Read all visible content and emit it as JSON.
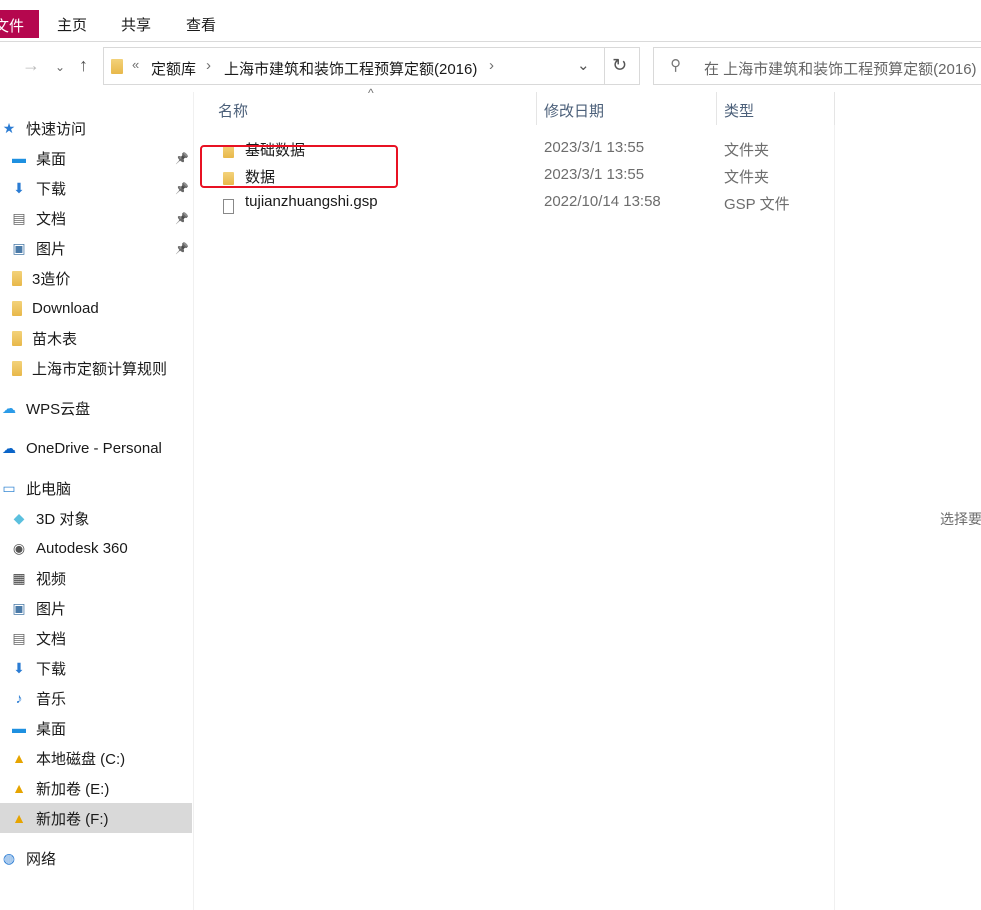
{
  "ribbon": {
    "tabs": [
      "文件",
      "主页",
      "共享",
      "查看"
    ],
    "accent": "#b5074e"
  },
  "address": {
    "prefix": "«",
    "crumbs": [
      "定额库",
      "上海市建筑和装饰工程预算定额(2016)"
    ]
  },
  "search": {
    "placeholder": "在 上海市建筑和装饰工程预算定额(2016)"
  },
  "columns": {
    "name": "名称",
    "date": "修改日期",
    "type": "类型"
  },
  "files": [
    {
      "name": "基础数据",
      "date": "2023/3/1 13:55",
      "type": "文件夹",
      "icon": "folder-icon"
    },
    {
      "name": "数据",
      "date": "2023/3/1 13:55",
      "type": "文件夹",
      "icon": "folder-icon"
    },
    {
      "name": "tujianzhuangshi.gsp",
      "date": "2022/10/14 13:58",
      "type": "GSP 文件",
      "icon": "file-icon"
    }
  ],
  "highlight_color": "#e81123",
  "sidebar": [
    {
      "label": "快速访问",
      "icon": "star-icon",
      "pinned": false
    },
    {
      "label": "桌面",
      "icon": "desktop-icon",
      "pinned": true
    },
    {
      "label": "下载",
      "icon": "download-icon",
      "pinned": true
    },
    {
      "label": "文档",
      "icon": "document-icon",
      "pinned": true
    },
    {
      "label": "图片",
      "icon": "pictures-icon",
      "pinned": true
    },
    {
      "label": "3造价",
      "icon": "folder-icon"
    },
    {
      "label": "Download",
      "icon": "folder-icon"
    },
    {
      "label": "苗木表",
      "icon": "folder-icon"
    },
    {
      "label": "上海市定额计算规则",
      "icon": "folder-icon"
    },
    {
      "label": "WPS云盘",
      "icon": "cloud-icon"
    },
    {
      "label": "OneDrive - Personal",
      "icon": "onedrive-icon"
    },
    {
      "label": "此电脑",
      "icon": "computer-icon"
    },
    {
      "label": "3D 对象",
      "icon": "3d-objects-icon"
    },
    {
      "label": "Autodesk 360",
      "icon": "autodesk-icon"
    },
    {
      "label": "视频",
      "icon": "video-icon"
    },
    {
      "label": "图片",
      "icon": "pictures-icon"
    },
    {
      "label": "文档",
      "icon": "document-icon"
    },
    {
      "label": "下载",
      "icon": "download-icon"
    },
    {
      "label": "音乐",
      "icon": "music-icon"
    },
    {
      "label": "桌面",
      "icon": "desktop-icon"
    },
    {
      "label": "本地磁盘 (C:)",
      "icon": "drive-icon"
    },
    {
      "label": "新加卷 (E:)",
      "icon": "drive-icon"
    },
    {
      "label": "新加卷 (F:)",
      "icon": "drive-icon",
      "selected": true
    },
    {
      "label": "网络",
      "icon": "network-icon"
    }
  ],
  "preview": {
    "text": "选择要"
  }
}
